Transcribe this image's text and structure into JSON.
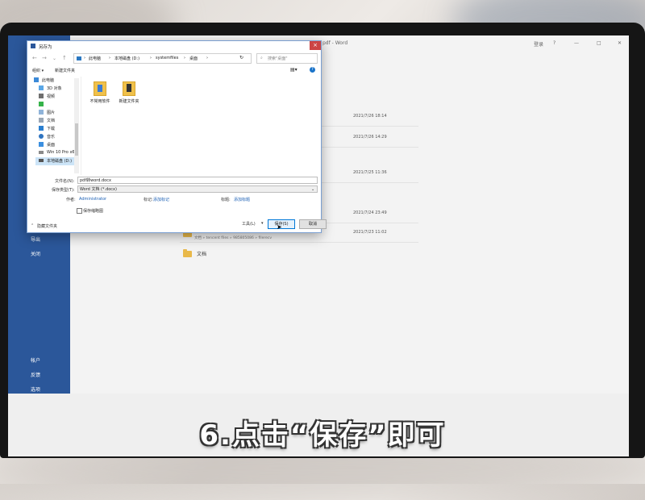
{
  "caption": "6.点击“保存”即可",
  "word": {
    "title_suffix": "pdf - Word",
    "login": "登录",
    "window_controls": [
      "?",
      "—",
      "□",
      "✕"
    ],
    "left_nav": [
      "导出",
      "关闭",
      "帐户",
      "反馈",
      "选项"
    ],
    "recent": [
      {
        "date": "2021/7/26 18:14"
      },
      {
        "date": "2021/7/26 14:29"
      },
      {
        "date": "2021/7/25 11:36"
      },
      {
        "date": "2021/7/24 23:49"
      },
      {
        "date": "2021/7/23 11:02",
        "path": "文档 » tencent files » 985805086 » filerecv"
      }
    ],
    "docs_folder": "文档"
  },
  "dialog": {
    "title": "另存为",
    "address": [
      "此电脑",
      "本地磁盘 (D:)",
      "systemfiles",
      "桌面"
    ],
    "search_placeholder": "搜索\"桌面\"",
    "organize": "组织 ▾",
    "new_folder": "新建文件夹",
    "tree": [
      "此电脑",
      "3D 对象",
      "视频",
      "图片",
      "文档",
      "下载",
      "音乐",
      "桌面",
      "Win 10 Pro x64",
      "本地磁盘 (D:)"
    ],
    "files": [
      "不常用软件",
      "新建文件夹"
    ],
    "filename_label": "文件名(N):",
    "filename_value": "pdf转word.docx",
    "filetype_label": "保存类型(T):",
    "filetype_value": "Word 文档 (*.docx)",
    "author_label": "作者:",
    "author_value": "Administrator",
    "tags_label": "标记:",
    "tags_value": "添加标记",
    "title_label": "标题:",
    "title_value": "添加标题",
    "thumbnail_label": "保存缩略图",
    "hide_folders": "隐藏文件夹",
    "tools": "工具(L)",
    "save": "保存(S)",
    "cancel": "取消"
  }
}
